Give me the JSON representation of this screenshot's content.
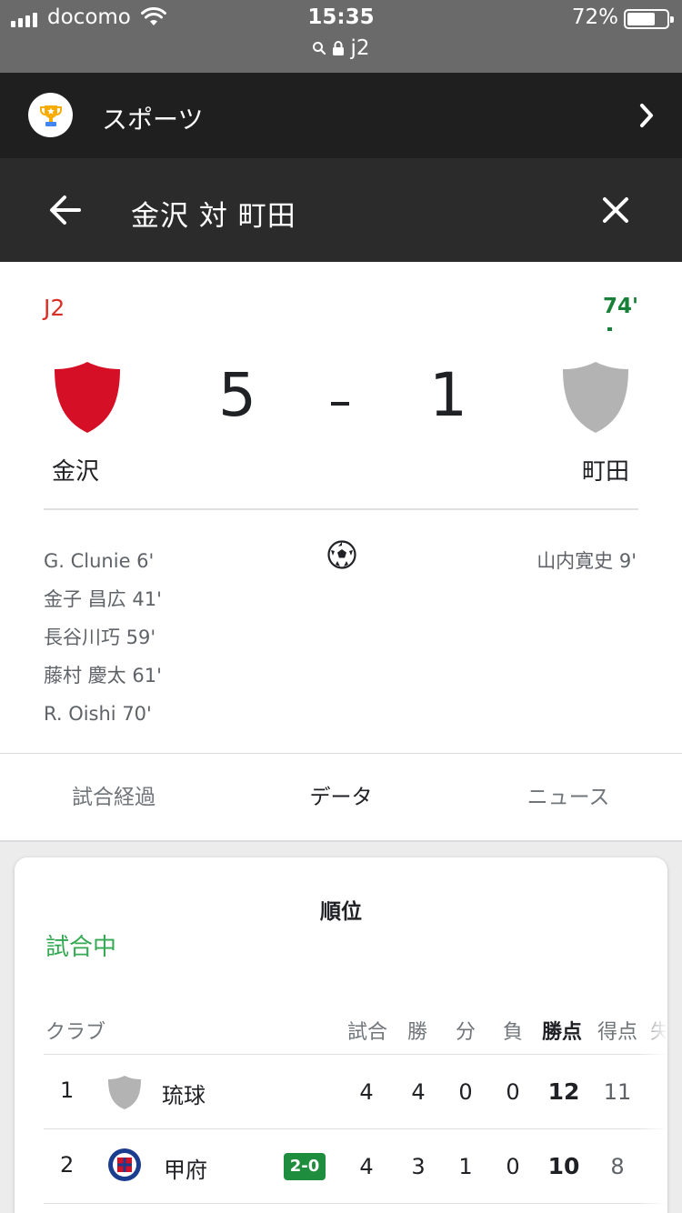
{
  "status_bar": {
    "carrier": "docomo",
    "time": "15:35",
    "battery": "72%",
    "battery_level": 0.72,
    "url": "j2"
  },
  "sports_bar": {
    "label": "スポーツ",
    "logo_icon": "trophy-icon",
    "chevron_icon": "chevron-right-icon"
  },
  "title_bar": {
    "title": "金沢 対 町田",
    "back_icon": "arrow-back-icon",
    "close_icon": "close-icon"
  },
  "match": {
    "league": "J2",
    "minute": "74'",
    "home": {
      "name": "金沢",
      "score": "5",
      "crest_color": "#d50f25"
    },
    "away": {
      "name": "町田",
      "score": "1",
      "crest_color": "#b3b3b3"
    },
    "home_scorers": [
      "G. Clunie 6'",
      "金子 昌広 41'",
      "長谷川巧 59'",
      "藤村 慶太 61'",
      "R. Oishi 70'"
    ],
    "away_scorers": [
      "山内寛史 9'"
    ]
  },
  "tabs": [
    "試合経過",
    "データ",
    "ニュース"
  ],
  "active_tab": 1,
  "standings": {
    "title": "順位",
    "status": "試合中",
    "headers": {
      "club": "クラブ",
      "played": "試合",
      "won": "勝",
      "drawn": "分",
      "lost": "負",
      "points": "勝点",
      "gf": "得点",
      "ga": "失"
    },
    "rows": [
      {
        "rank": "1",
        "club": "琉球",
        "badge": "",
        "played": "4",
        "won": "4",
        "drawn": "0",
        "lost": "0",
        "points": "12",
        "gf": "11"
      },
      {
        "rank": "2",
        "club": "甲府",
        "badge": "2-0",
        "played": "4",
        "won": "3",
        "drawn": "1",
        "lost": "0",
        "points": "10",
        "gf": "8"
      }
    ]
  },
  "colors": {
    "live_green": "#188038",
    "league_red": "#d93025",
    "badge_green": "#1e8e3e"
  }
}
